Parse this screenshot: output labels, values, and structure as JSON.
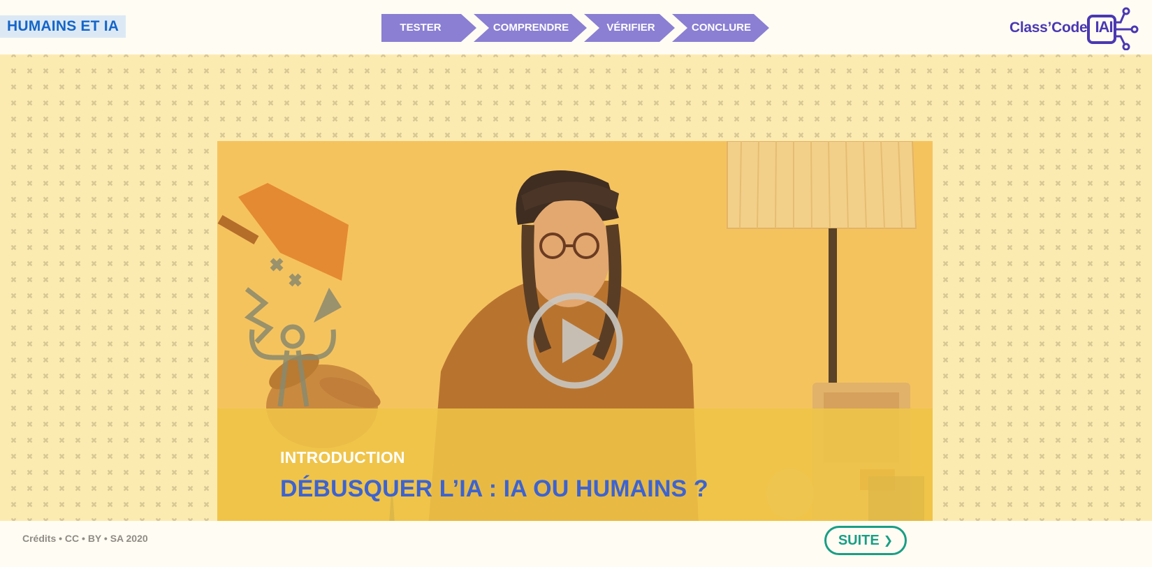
{
  "header": {
    "site_title": "HUMAINS ET IA",
    "steps": [
      {
        "label": "TESTER"
      },
      {
        "label": "COMPRENDRE"
      },
      {
        "label": "VÉRIFIER"
      },
      {
        "label": "CONCLURE"
      }
    ],
    "logo": {
      "text": "Class’Code",
      "badge": "IAI"
    }
  },
  "video": {
    "kicker": "INTRODUCTION",
    "title": "DÉBUSQUER L’IA : IA OU HUMAINS ?",
    "play_icon": "play-circle-icon"
  },
  "footer": {
    "credits": "Crédits • CC • BY • SA 2020",
    "next_label": "SUITE",
    "next_icon": "chevron-right-icon"
  },
  "colors": {
    "step_purple": "#8a7fd3",
    "title_blue": "#1565c8",
    "accent_green": "#199e85",
    "logo_purple": "#4a38b2",
    "background_yellow": "#fcebb1"
  }
}
